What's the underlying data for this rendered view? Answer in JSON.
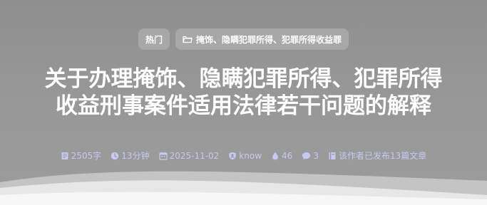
{
  "tags": {
    "hot": "热门",
    "category": "掩饰、隐瞒犯罪所得、犯罪所得收益罪"
  },
  "title": {
    "line1": "关于办理掩饰、隐瞒犯罪所得、犯罪所得",
    "line2": "收益刑事案件适用法律若干问题的解释"
  },
  "meta": {
    "word_count": "2505字",
    "read_time": "13分钟",
    "date": "2025-11-02",
    "author": "know",
    "views": "46",
    "comments": "3",
    "author_posts": "该作者已发布13篇文章"
  },
  "icons": {
    "folder": "folder-icon",
    "words": "document-icon",
    "time": "clock-icon",
    "date": "calendar-icon",
    "author": "user-badge-icon",
    "views": "drop-icon",
    "comments": "chat-bubble-icon",
    "posts": "book-icon"
  },
  "colors": {
    "background": "#979797",
    "meta_text": "#c7c9ef",
    "title_text": "#ffffff"
  }
}
